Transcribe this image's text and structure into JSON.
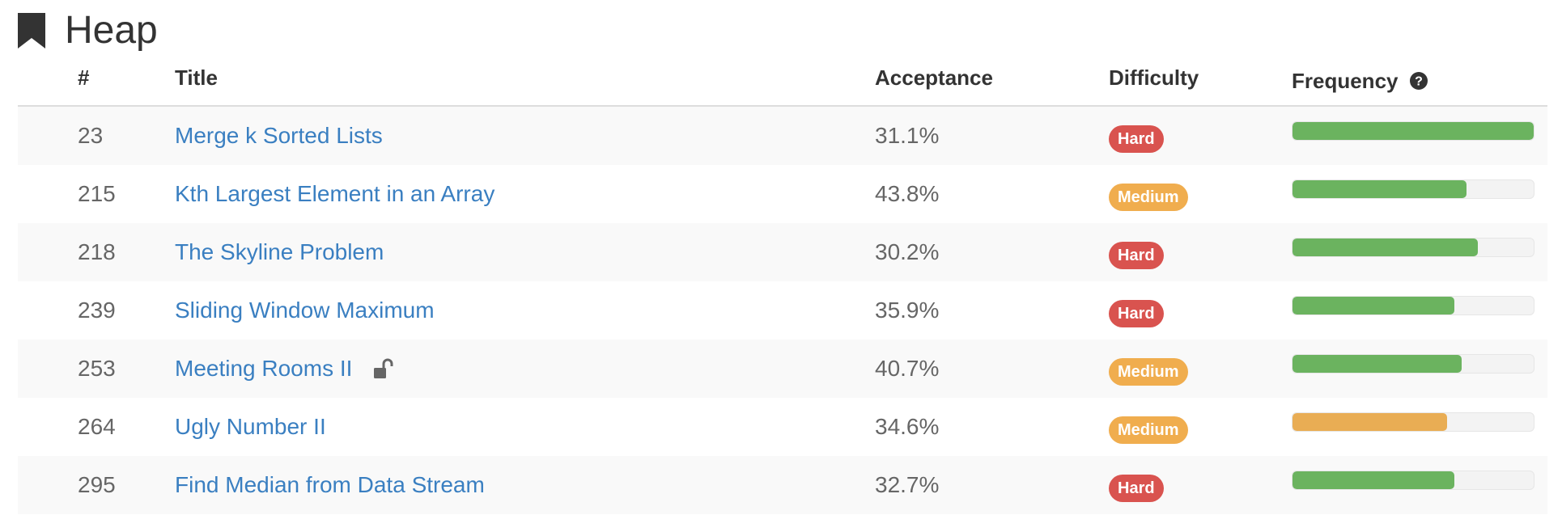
{
  "header": {
    "title": "Heap",
    "icon": "bookmark-icon"
  },
  "table": {
    "columns": {
      "num": "#",
      "title": "Title",
      "acceptance": "Acceptance",
      "difficulty": "Difficulty",
      "frequency": "Frequency"
    },
    "rows": [
      {
        "num": "23",
        "title": "Merge k Sorted Lists",
        "locked": false,
        "acceptance": "31.1%",
        "difficulty": "Hard",
        "frequency": 1.0,
        "frequency_color": "green"
      },
      {
        "num": "215",
        "title": "Kth Largest Element in an Array",
        "locked": false,
        "acceptance": "43.8%",
        "difficulty": "Medium",
        "frequency": 0.72,
        "frequency_color": "green"
      },
      {
        "num": "218",
        "title": "The Skyline Problem",
        "locked": false,
        "acceptance": "30.2%",
        "difficulty": "Hard",
        "frequency": 0.77,
        "frequency_color": "green"
      },
      {
        "num": "239",
        "title": "Sliding Window Maximum",
        "locked": false,
        "acceptance": "35.9%",
        "difficulty": "Hard",
        "frequency": 0.67,
        "frequency_color": "green"
      },
      {
        "num": "253",
        "title": "Meeting Rooms II",
        "locked": true,
        "acceptance": "40.7%",
        "difficulty": "Medium",
        "frequency": 0.7,
        "frequency_color": "green"
      },
      {
        "num": "264",
        "title": "Ugly Number II",
        "locked": false,
        "acceptance": "34.6%",
        "difficulty": "Medium",
        "frequency": 0.64,
        "frequency_color": "orange"
      },
      {
        "num": "295",
        "title": "Find Median from Data Stream",
        "locked": false,
        "acceptance": "32.7%",
        "difficulty": "Hard",
        "frequency": 0.67,
        "frequency_color": "green"
      }
    ]
  },
  "colors": {
    "link": "#3a7fc1",
    "hard": "#d9534f",
    "medium": "#f0ad4e",
    "frequency_green": "#6bb35f",
    "frequency_orange": "#e9ad54"
  }
}
